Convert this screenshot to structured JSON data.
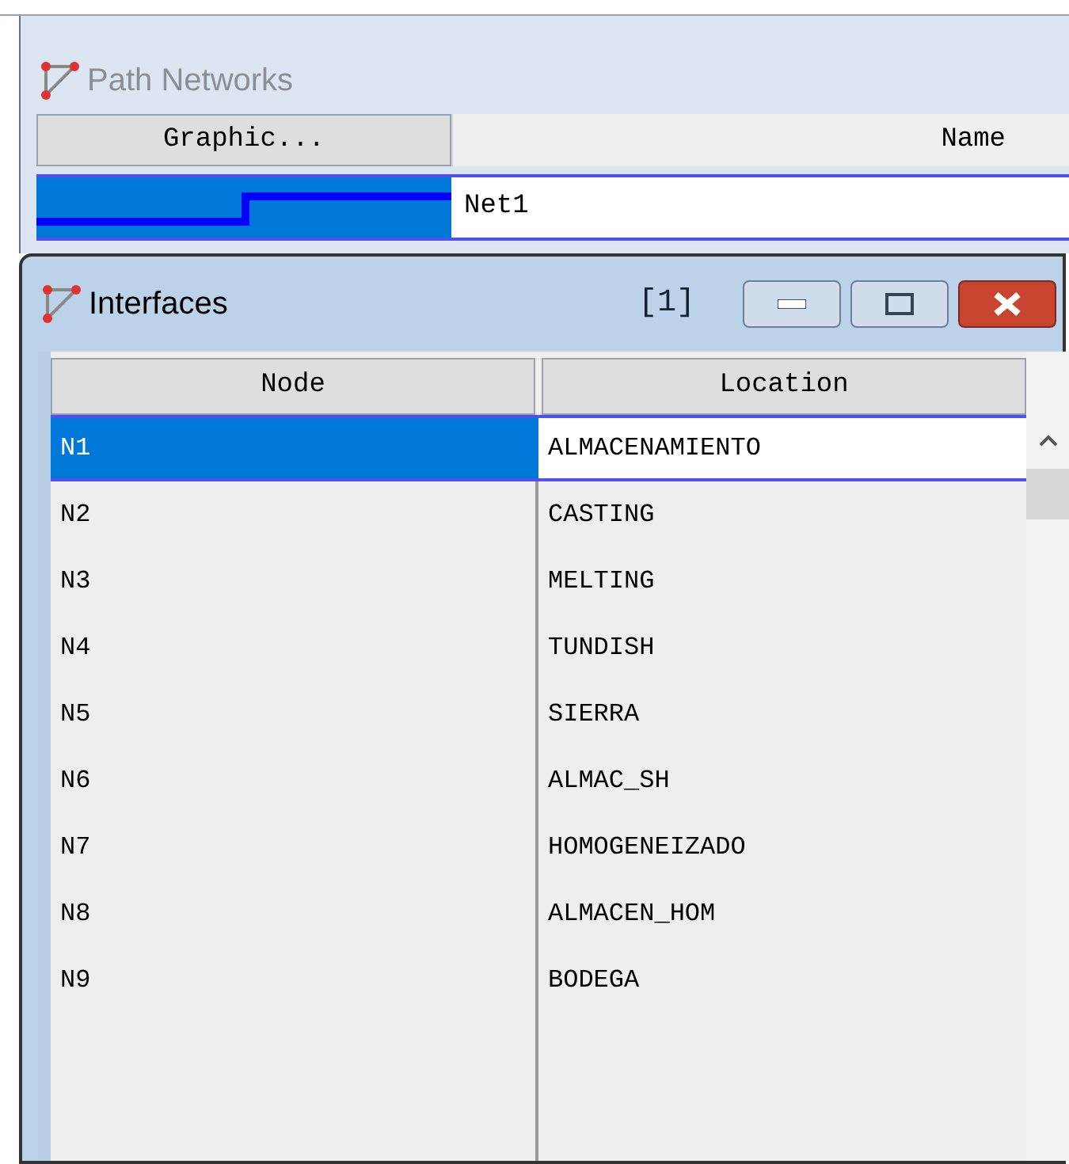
{
  "path_networks": {
    "title": "Path Networks",
    "columns": [
      "Graphic...",
      "Name"
    ],
    "rows": [
      {
        "name": "Net1",
        "selected": true
      }
    ]
  },
  "interfaces": {
    "title": "Interfaces",
    "count": "[1]",
    "columns": [
      "Node",
      "Location"
    ],
    "rows": [
      {
        "node": "N1",
        "location": "ALMACENAMIENTO",
        "selected": true
      },
      {
        "node": "N2",
        "location": "CASTING",
        "selected": false
      },
      {
        "node": "N3",
        "location": "MELTING",
        "selected": false
      },
      {
        "node": "N4",
        "location": "TUNDISH",
        "selected": false
      },
      {
        "node": "N5",
        "location": "SIERRA",
        "selected": false
      },
      {
        "node": "N6",
        "location": "ALMAC_SH",
        "selected": false
      },
      {
        "node": "N7",
        "location": "HOMOGENEIZADO",
        "selected": false
      },
      {
        "node": "N8",
        "location": "ALMACEN_HOM",
        "selected": false
      },
      {
        "node": "N9",
        "location": "BODEGA",
        "selected": false
      }
    ]
  }
}
